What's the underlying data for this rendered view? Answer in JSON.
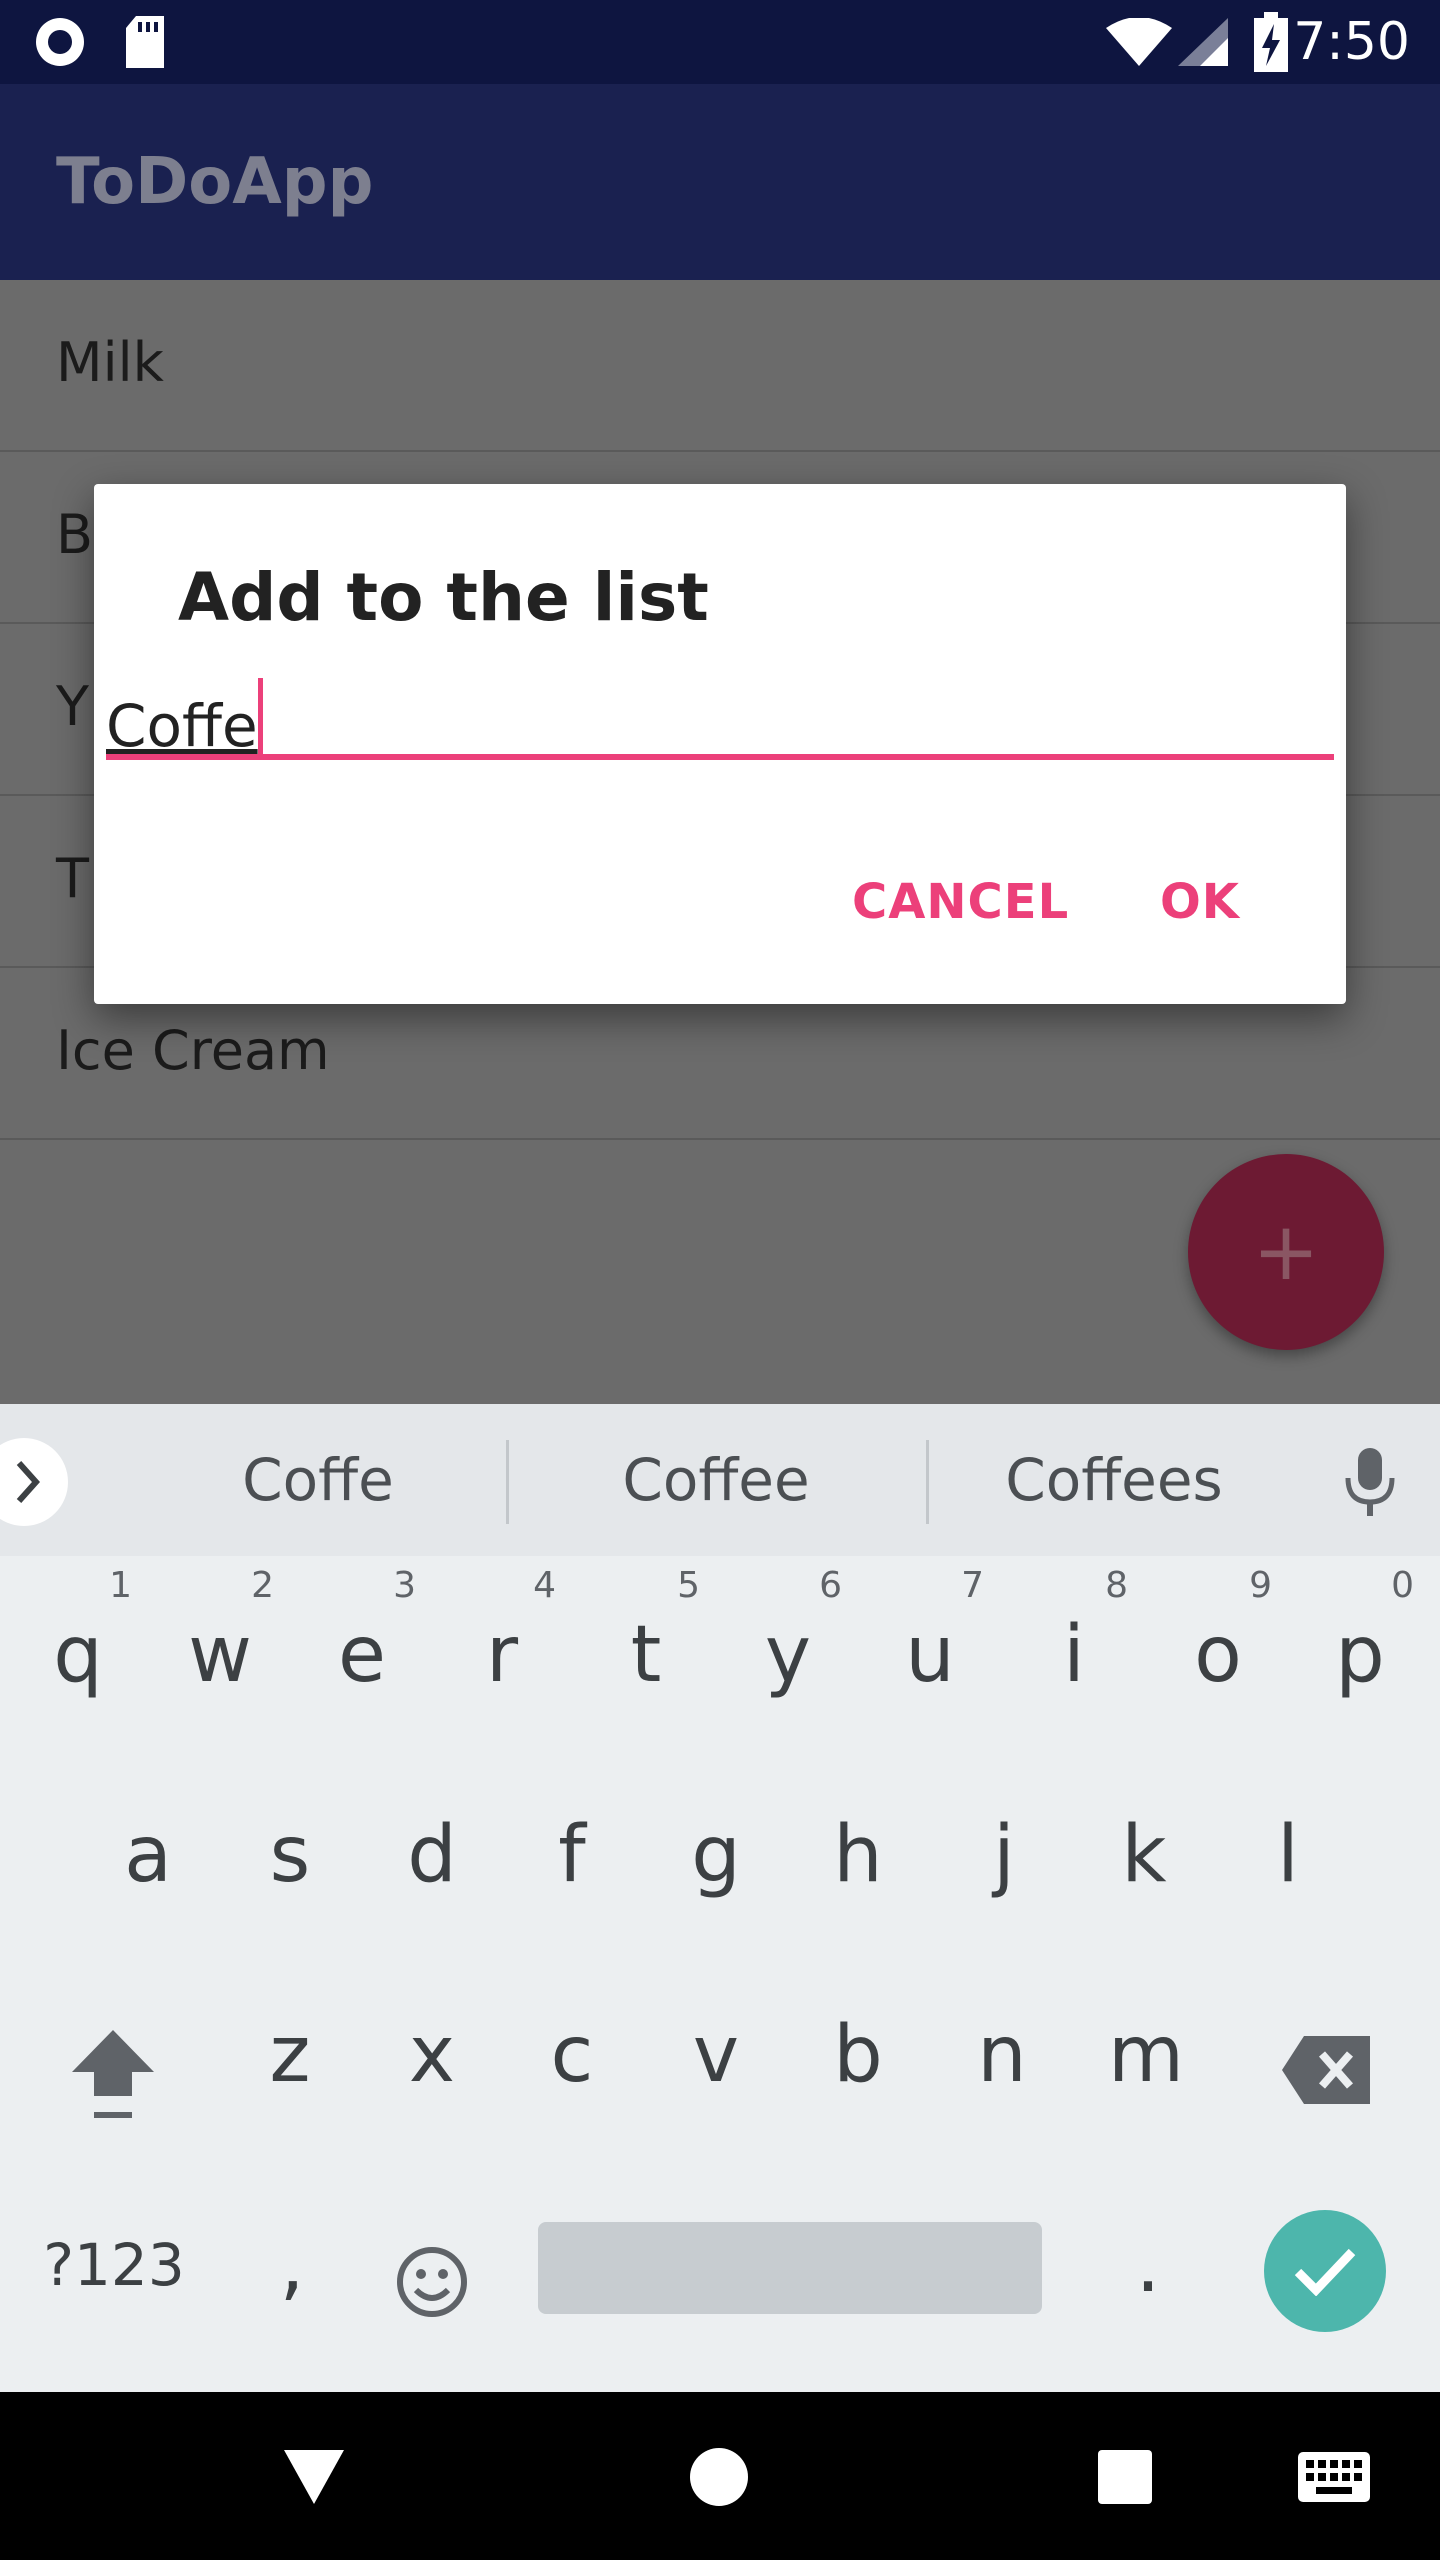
{
  "status_bar": {
    "time": "7:50"
  },
  "app_bar": {
    "title": "ToDoApp"
  },
  "list": {
    "items": [
      "Milk",
      "B",
      "Y",
      "T",
      "Ice Cream"
    ]
  },
  "fab": {
    "label": "+"
  },
  "dialog": {
    "title": "Add to the list",
    "input_value": "Coffe",
    "cancel_label": "CANCEL",
    "ok_label": "OK"
  },
  "keyboard": {
    "suggestions": [
      "Coffe",
      "Coffee",
      "Coffees"
    ],
    "row1": [
      {
        "ch": "q",
        "num": "1"
      },
      {
        "ch": "w",
        "num": "2"
      },
      {
        "ch": "e",
        "num": "3"
      },
      {
        "ch": "r",
        "num": "4"
      },
      {
        "ch": "t",
        "num": "5"
      },
      {
        "ch": "y",
        "num": "6"
      },
      {
        "ch": "u",
        "num": "7"
      },
      {
        "ch": "i",
        "num": "8"
      },
      {
        "ch": "o",
        "num": "9"
      },
      {
        "ch": "p",
        "num": "0"
      }
    ],
    "row2": [
      "a",
      "s",
      "d",
      "f",
      "g",
      "h",
      "j",
      "k",
      "l"
    ],
    "row3": [
      "z",
      "x",
      "c",
      "v",
      "b",
      "n",
      "m"
    ],
    "symbols_label": "?123",
    "comma": ",",
    "period": "."
  },
  "colors": {
    "accent": "#ec407a",
    "app_bar": "#1a2150",
    "enter_key": "#4db6ac"
  },
  "icons": [
    "radio-icon",
    "sd-card-icon",
    "wifi-icon",
    "signal-icon",
    "battery-charging-icon",
    "chevron-right-icon",
    "mic-icon",
    "shift-icon",
    "backspace-icon",
    "emoji-icon",
    "check-icon",
    "back-icon",
    "home-icon",
    "recents-icon",
    "keyboard-icon"
  ]
}
